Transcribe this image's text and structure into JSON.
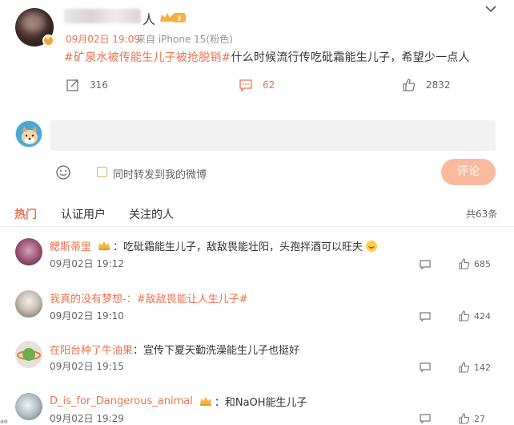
{
  "post": {
    "author_suffix": "人",
    "vip_level": "Ⅱ",
    "time": "09月02日 19:09",
    "source": "来自 iPhone 15(粉色)",
    "hashtag1": "#矿泉水被传能生儿子被抢脱销#",
    "text": "什么时候流行传吃砒霜能生儿子，希望少一点人",
    "repost_count": "316",
    "comment_count": "62",
    "like_count": "2832"
  },
  "composer": {
    "placeholder": "",
    "also_repost_label": "同时转发到我的微博",
    "submit_label": "评论"
  },
  "tabs": [
    "热门",
    "认证用户",
    "关注的人"
  ],
  "total_label": "共63条",
  "comments": [
    {
      "user": "鳃斯蒂里",
      "sep": "：",
      "text": "吃砒霜能生儿子，敌敌畏能壮阳，头孢拌酒可以旺夫",
      "time": "09月02日 19:12",
      "likes": "685"
    },
    {
      "user": "我真的没有梦想-",
      "sep": "：",
      "text": "#敌敌畏能让人生儿子#",
      "time": "09月02日 19:10",
      "likes": "424"
    },
    {
      "user": "在阳台种了牛油果",
      "sep": "：",
      "text": "宣传下夏天勤洗澡能生儿子也挺好",
      "time": "09月02日 19:15",
      "likes": "142"
    },
    {
      "user": "D_is_for_Dangerous_animal",
      "sep": "：",
      "text": "和NaOH能生儿子",
      "time": "09月02日 19:29",
      "likes": "27"
    }
  ],
  "edge_glyph": "ae",
  "colors": {
    "accent": "#eb7350",
    "submit_bg": "#f9ba9f",
    "input_bg": "#f2f2f2"
  },
  "icons": [
    "dropdown-chevron",
    "repost",
    "comment",
    "like",
    "emoji",
    "reply",
    "crown"
  ]
}
